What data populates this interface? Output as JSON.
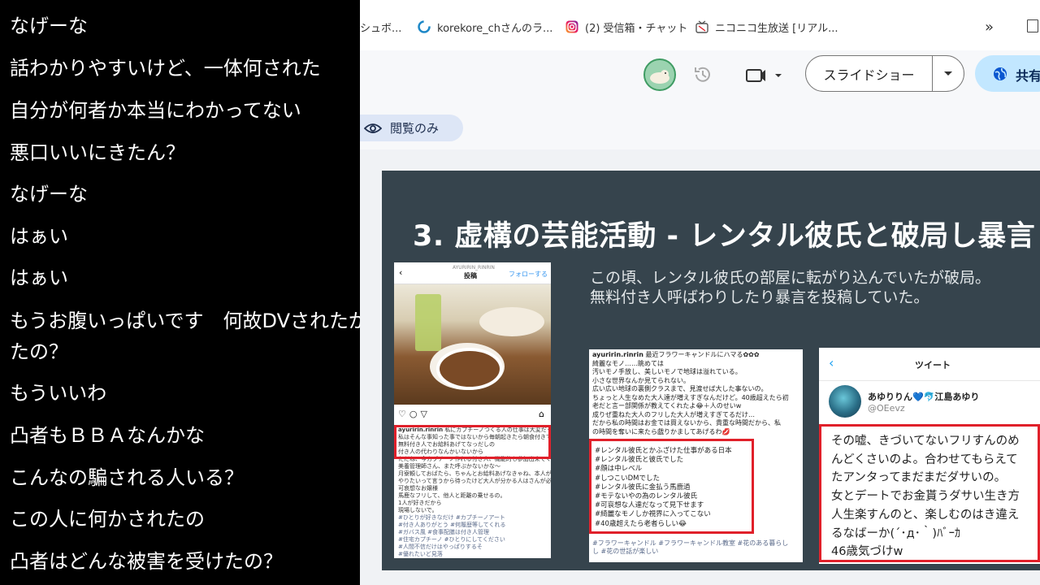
{
  "comments": [
    "なげーな",
    "話わかりやすいけど、一体何された",
    "自分が何者か本当にわかってない",
    "悪口いいにきたん？",
    "なげーな",
    "はぁい",
    "はぁい",
    "もうお腹いっぱいです　何故DVされたがったの？",
    "もういいわ",
    "凸者もＢＢＡなんかな",
    "こんなの騙される人いる？",
    "この人に何かされたの",
    "凸者はどんな被害を受けたの？"
  ],
  "bookmarks": [
    {
      "label": "シュボ...",
      "icon": "bookmark-partial-icon"
    },
    {
      "label": "korekore_chさんのラ...",
      "icon": "korekore-icon"
    },
    {
      "label": "(2) 受信箱・チャット",
      "icon": "instagram-icon"
    },
    {
      "label": "ニコニコ生放送 [リアル...",
      "icon": "niconico-icon"
    }
  ],
  "bookmarks_more": "»",
  "toolbar": {
    "slideshow_label": "スライドショー",
    "share_label": "共有",
    "view_only_label": "閲覧のみ"
  },
  "slide": {
    "title": "3. 虚構の芸能活動 - レンタル彼氏と破局し暴言",
    "body_line1": "この頃、レンタル彼氏の部屋に転がり込んでいたが破局。",
    "body_line2": "無料付き人呼ばわりしたり暴言を投稿していた。"
  },
  "insta": {
    "header_user": "AYURIRIN_RINRIN",
    "header_title": "投稿",
    "follow_label": "フォローする",
    "caption_user": "ayuririn.rinrin",
    "caption_lines": [
      "私にカプチーノつくる人の仕事は大変だったの、",
      "私はそんな事知った事ではないから毎朝起きたら朝食付きで",
      "無料付き人でお給料あげてなっだしの",
      "付き人の代わりなんかいないから",
      "ただね、今カプチーノ作れる付き人、機能的も参加出来てくれる",
      "美養管理師さん、また呼ぶかないかな～",
      "月寮頼しておばたら、ちゃんとお給料あげなきゃね、本人が無料で",
      "やりたいって言うから待ったけど大人が分かる人はさんが必ず、幸せ者。",
      "可哀想なお嬢様",
      "馬鹿なフリして、他人と距離の乗せるの。",
      "1人が好きだから",
      "現場しないで。",
      "#ひとりが好きなだけ #カプチーノアート",
      "#付き人ありがとう #何履歴等してくれる",
      "#ガバス風 #食事配膳は付き人管理",
      "#住宅カプチーノ #ひとりにしてください",
      "#人間不信だけはやっぱりするそ",
      "#優れたいど見落"
    ]
  },
  "post2": {
    "head_user": "ayuririn.rinrin",
    "head_text": "最近フラワーキャンドルにハマる✿✿✿",
    "lines": [
      "綺麗なモノ……眺めては",
      "汚いモノ手放し、美しいモノで地球は溢れている。",
      "小さな世界なんか見てられない。",
      "広い広い地球の裏側クラスまで、見渡せば大した事ないの。",
      "ちょっと人生なめた大人達が増えすぎなんだけど。40歳超えたら初",
      "老だと言ー部関係が教えてくれたよ😂＋人のせいw",
      "成りぜ重ねた大人のフリした大人が増えすぎてるだけ…",
      "だから私の時間はお金では買えないから、貴重な時間だから、私",
      "の時間を奪いに来たら戯りかましてあげるわ💋"
    ],
    "tags": [
      "#レンタル彼氏とかふざけた仕事がある日本",
      "#レンタル彼氏と彼氏でした",
      "#顔は中レベル",
      "#しつこいDMでした",
      "#レンタル彼氏に金払う馬鹿過",
      "#モテないやの為のレンタル彼氏",
      "#可哀想な人達だなって見下せます",
      "#綺麗なモノしか視界に入ってこない",
      "#40歳超えたら老者らしい😂"
    ],
    "footer1": "#フラワーキャンドル #フラワーキャンドル教室 #花のある暮らし",
    "footer2": "し #花の世話が楽しい"
  },
  "tweet": {
    "header": "ツイート",
    "name": "あゆりりん💙🐬江島あゆり",
    "handle": "@OEevz",
    "lines": [
      "その嘘、きづいてないフリすんのめ",
      "んどくさいのよ。合わせてもらえて",
      "たアンタってまだまだダサいの。",
      "女とデートでお金貰うダサい生き方",
      "人生楽すんのと、楽しむのはき違え",
      "るなばーか(´･д･｀)ﾊﾞｰｶ",
      "46歳気づけw"
    ]
  },
  "colors": {
    "slide_bg": "#36444d",
    "accent_red": "#e0202a",
    "view_chip": "#dde6f6",
    "share_blue": "#c2e7ff"
  }
}
